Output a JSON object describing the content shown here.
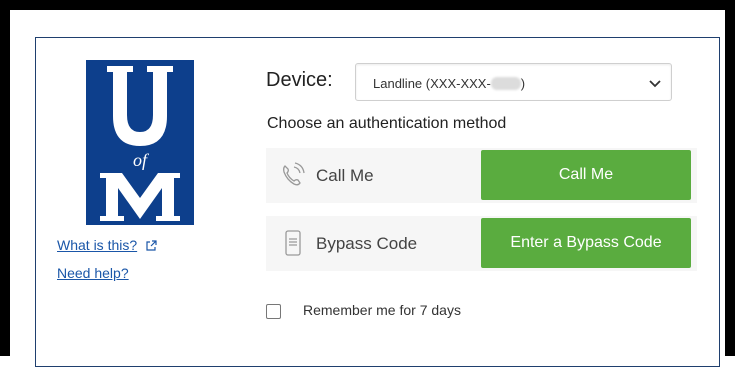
{
  "logo": {
    "letters": [
      "U",
      "of",
      "M"
    ]
  },
  "links": {
    "what_is_this": "What is this?",
    "need_help": "Need help?"
  },
  "device": {
    "label": "Device:",
    "selected_prefix": "Landline (XXX-XXX-",
    "selected_suffix": ")"
  },
  "auth": {
    "prompt": "Choose an authentication method",
    "methods": [
      {
        "label": "Call Me",
        "button": "Call Me",
        "icon": "phone-ringing-icon"
      },
      {
        "label": "Bypass Code",
        "button": "Enter a Bypass Code",
        "icon": "device-code-icon"
      }
    ]
  },
  "remember": {
    "label": "Remember me for 7 days",
    "checked": false
  },
  "colors": {
    "brand_blue": "#0d3f8c",
    "button_green": "#5aac3f",
    "link_blue": "#1a56a8",
    "row_background": "#f6f6f6"
  }
}
